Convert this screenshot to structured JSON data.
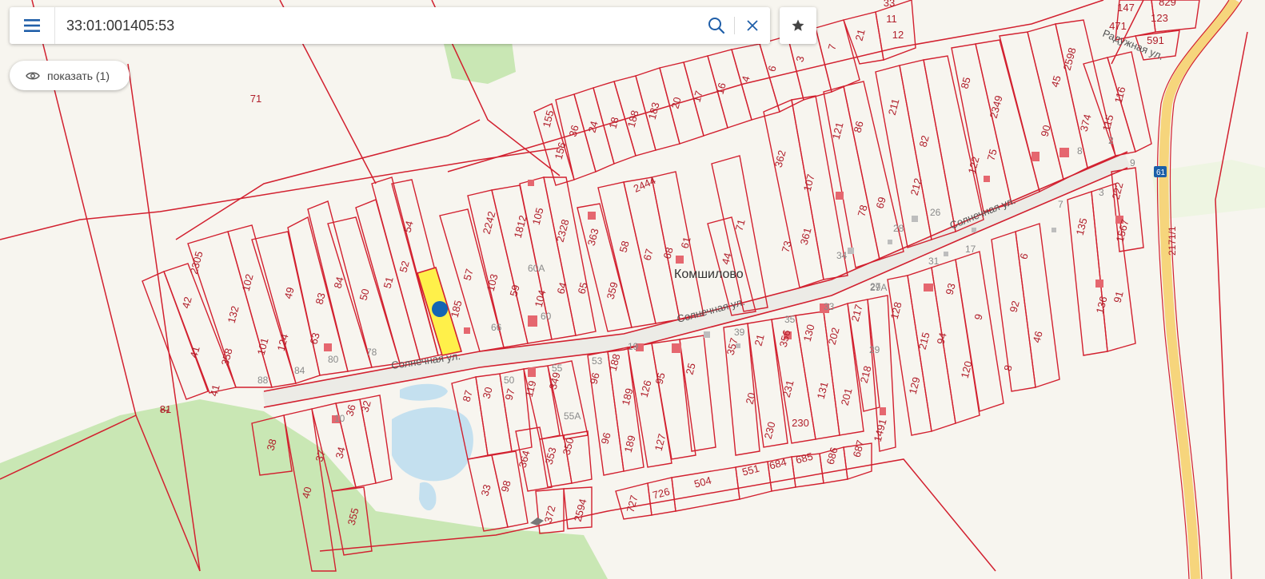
{
  "search": {
    "value": "33:01:001405:53",
    "menu_icon": "menu-icon",
    "search_icon": "search-icon",
    "clear_icon": "close-icon"
  },
  "favorites": {
    "icon": "star-icon"
  },
  "show_button": {
    "icon": "eye-icon",
    "label": "показать (1)"
  },
  "map": {
    "village": "Комшилово",
    "streets": [
      {
        "name": "Солнечная ул."
      },
      {
        "name": "Солнечная ул."
      },
      {
        "name": "Солнечная ул."
      },
      {
        "name": "Радужная ул."
      }
    ],
    "road_number": "2171/1",
    "road_badge": "61",
    "selected_parcel": "33:01:001405:53",
    "colors": {
      "background": "#f7f5ef",
      "green_area": "#c9e7b4",
      "water": "#c4e0ef",
      "boundary": "#d2202f",
      "selected_fill": "#fff04a",
      "marker": "#1565b3",
      "road": "#f6d57c"
    },
    "plot_labels": [
      "71",
      "1",
      "42",
      "41",
      "2305",
      "132",
      "358",
      "41",
      "102",
      "101",
      "124",
      "49",
      "63",
      "83",
      "84",
      "50",
      "51",
      "54",
      "52",
      "185",
      "57",
      "103",
      "2242",
      "59",
      "1812",
      "105",
      "104",
      "2328",
      "64",
      "65",
      "363",
      "58",
      "359",
      "67",
      "2444",
      "68",
      "61",
      "71",
      "44",
      "73",
      "362",
      "107",
      "361",
      "121",
      "86",
      "78",
      "69",
      "211",
      "212",
      "82",
      "85",
      "2349",
      "122",
      "75",
      "90",
      "45",
      "2598",
      "374",
      "115",
      "116",
      "222",
      "1567",
      "135",
      "136",
      "91",
      "92",
      "46",
      "6",
      "93",
      "94",
      "9",
      "8",
      "120",
      "128",
      "215",
      "129",
      "217",
      "218",
      "1491",
      "202",
      "201",
      "130",
      "131",
      "230",
      "231",
      "356",
      "357",
      "20",
      "21",
      "230",
      "25",
      "95",
      "127",
      "126",
      "189",
      "188",
      "96",
      "119",
      "349",
      "350",
      "353",
      "364",
      "97",
      "87",
      "30",
      "98",
      "33",
      "36",
      "32",
      "38",
      "37",
      "34",
      "40",
      "355",
      "372",
      "2594",
      "727",
      "726",
      "504",
      "551",
      "684",
      "685",
      "686",
      "687",
      "155",
      "156",
      "36",
      "24",
      "18",
      "188",
      "183",
      "20",
      "17",
      "16",
      "4",
      "6",
      "3",
      "7",
      "21",
      "33",
      "11",
      "12",
      "147",
      "829",
      "123",
      "471",
      "591",
      "96",
      "189",
      "81"
    ],
    "house_labels": [
      "88",
      "84",
      "80",
      "78",
      "66",
      "60",
      "60A",
      "55",
      "55A",
      "50",
      "39",
      "35",
      "33",
      "29",
      "29A",
      "27",
      "28",
      "26",
      "34",
      "31",
      "17",
      "7",
      "3",
      "2",
      "8",
      "53",
      "9",
      "19",
      "10"
    ]
  }
}
